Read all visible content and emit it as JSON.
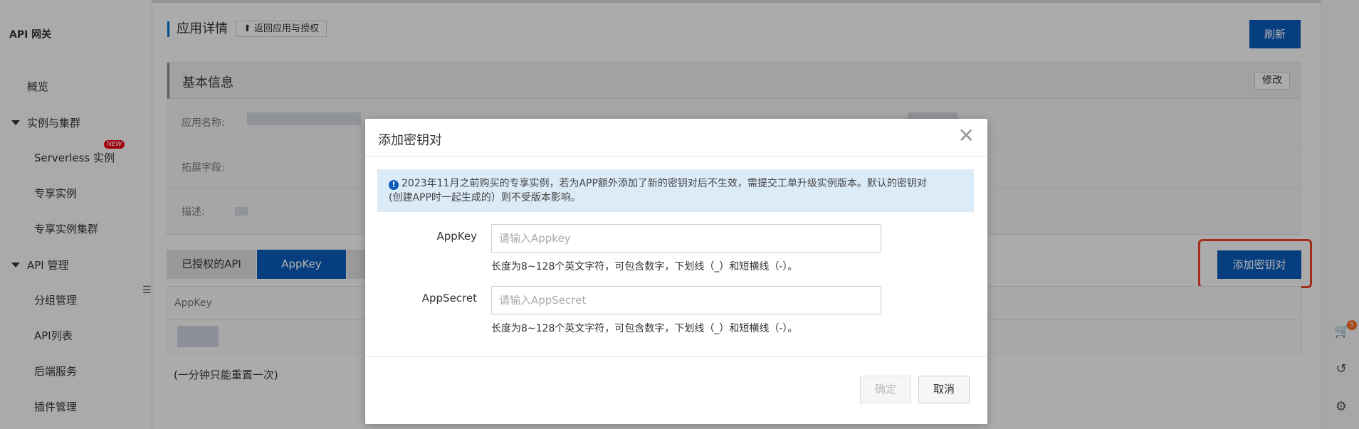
{
  "sidebar": {
    "title": "API 网关",
    "items": [
      {
        "label": "概览"
      },
      {
        "label": "实例与集群"
      },
      {
        "label": "Serverless 实例"
      },
      {
        "label": "专享实例"
      },
      {
        "label": "专享实例集群"
      },
      {
        "label": "API 管理"
      },
      {
        "label": "分组管理"
      },
      {
        "label": "API列表"
      },
      {
        "label": "后端服务"
      },
      {
        "label": "插件管理"
      }
    ],
    "new_badge": "NEW"
  },
  "header": {
    "title": "应用详情",
    "back_label": "返回应用与授权",
    "refresh_label": "刷新"
  },
  "basic_info": {
    "title": "基本信息",
    "edit_label": "修改",
    "fields": {
      "app_name": "应用名称:",
      "ext_field": "拓展字段:",
      "description": "描述:"
    }
  },
  "tabs": [
    {
      "label": "已授权的API"
    },
    {
      "label": "AppKey"
    }
  ],
  "actions": {
    "add_key_pair": "添加密钥对"
  },
  "table": {
    "columns": [
      "AppKey"
    ]
  },
  "footnote": "(一分钟只能重置一次)",
  "rail": {
    "cart_count": "5"
  },
  "modal": {
    "title": "添加密钥对",
    "info_line1": "2023年11月之前购买的专享实例，若为APP额外添加了新的密钥对后不生效，需提交工单升级实例版本。默认的密钥对",
    "info_line2": "(创建APP时一起生成的）则不受版本影响。",
    "appkey": {
      "label": "AppKey",
      "placeholder": "请输入Appkey",
      "value": "",
      "hint": "长度为8~128个英文字符，可包含数字，下划线（_）和短横线（-）。"
    },
    "appsecret": {
      "label": "AppSecret",
      "placeholder": "请输入AppSecret",
      "value": "",
      "hint": "长度为8~128个英文字符，可包含数字，下划线（_）和短横线（-）。"
    },
    "confirm_label": "确定",
    "cancel_label": "取消"
  },
  "colors": {
    "primary": "#0a5ab8",
    "highlight": "#e8432a",
    "accent": "#f0641e"
  }
}
